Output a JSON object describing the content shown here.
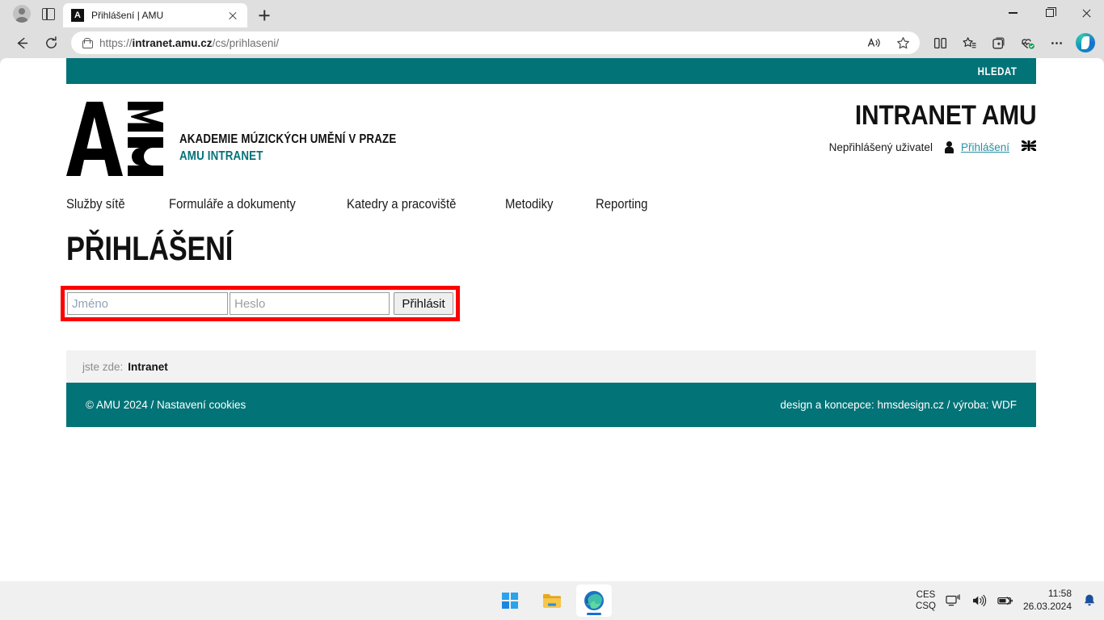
{
  "browser": {
    "tab": {
      "title": "Přihlášení | AMU",
      "favicon_letter": "A",
      "favicon_name": "amu-favicon"
    },
    "address": {
      "url_prefix": "https://",
      "url_host": "intranet.amu.cz",
      "url_path": "/cs/prihlaseni/",
      "full_url": "https://intranet.amu.cz/cs/prihlaseni/"
    },
    "icons": {
      "profile": "profile-icon",
      "tab_list": "tab-list-icon",
      "new_tab": "new-tab-icon",
      "close_tab": "close-tab-icon",
      "back": "back-arrow-icon",
      "refresh": "refresh-icon",
      "lock": "lock-icon",
      "read_aloud": "read-aloud-icon",
      "favorite": "star-icon",
      "split_screen": "split-screen-icon",
      "favorites_bar": "favorites-list-icon",
      "collections": "collections-icon",
      "browser_essentials": "browser-essentials-icon",
      "settings_more": "more-options-icon",
      "copilot": "copilot-icon",
      "minimize": "minimize-icon",
      "maximize": "maximize-icon",
      "close_window": "close-window-icon"
    }
  },
  "site": {
    "search_label": "HLEDAT",
    "logo_alt": "AMU",
    "brand_line1": "AKADEMIE MÚZICKÝCH UMĚNÍ V PRAZE",
    "brand_line2": "AMU INTRANET",
    "intranet_title": "INTRANET AMU",
    "user_status": "Nepřihlášený uživatel",
    "login_link": "Přihlášení",
    "lang_flag": "uk-flag-icon",
    "nav": [
      {
        "label": "Služby sítě"
      },
      {
        "label": "Formuláře a dokumenty"
      },
      {
        "label": "Katedry a pracoviště"
      },
      {
        "label": "Metodiky"
      },
      {
        "label": "Reporting"
      }
    ],
    "page_title": "PŘIHLÁŠENÍ",
    "form": {
      "username_placeholder": "Jméno",
      "username_value": "",
      "password_placeholder": "Heslo",
      "password_value": "",
      "submit_label": "Přihlásit"
    },
    "breadcrumb": {
      "label": "jste zde:",
      "current": "Intranet"
    },
    "footer": {
      "left": "© AMU 2024 / Nastavení cookies",
      "right": "design a koncepce: hmsdesign.cz / výroba: WDF"
    },
    "colors": {
      "teal": "#027377",
      "link_teal": "#2791a5",
      "highlight_red": "#ff0000"
    }
  },
  "taskbar": {
    "start": "windows-start-icon",
    "file_explorer": "file-explorer-icon",
    "edge": "microsoft-edge-icon",
    "lang_line1": "CES",
    "lang_line2": "CSQ",
    "network": "network-icon",
    "volume": "volume-icon",
    "battery": "battery-icon",
    "time": "11:58",
    "date": "26.03.2024",
    "notifications": "notification-bell-icon"
  }
}
